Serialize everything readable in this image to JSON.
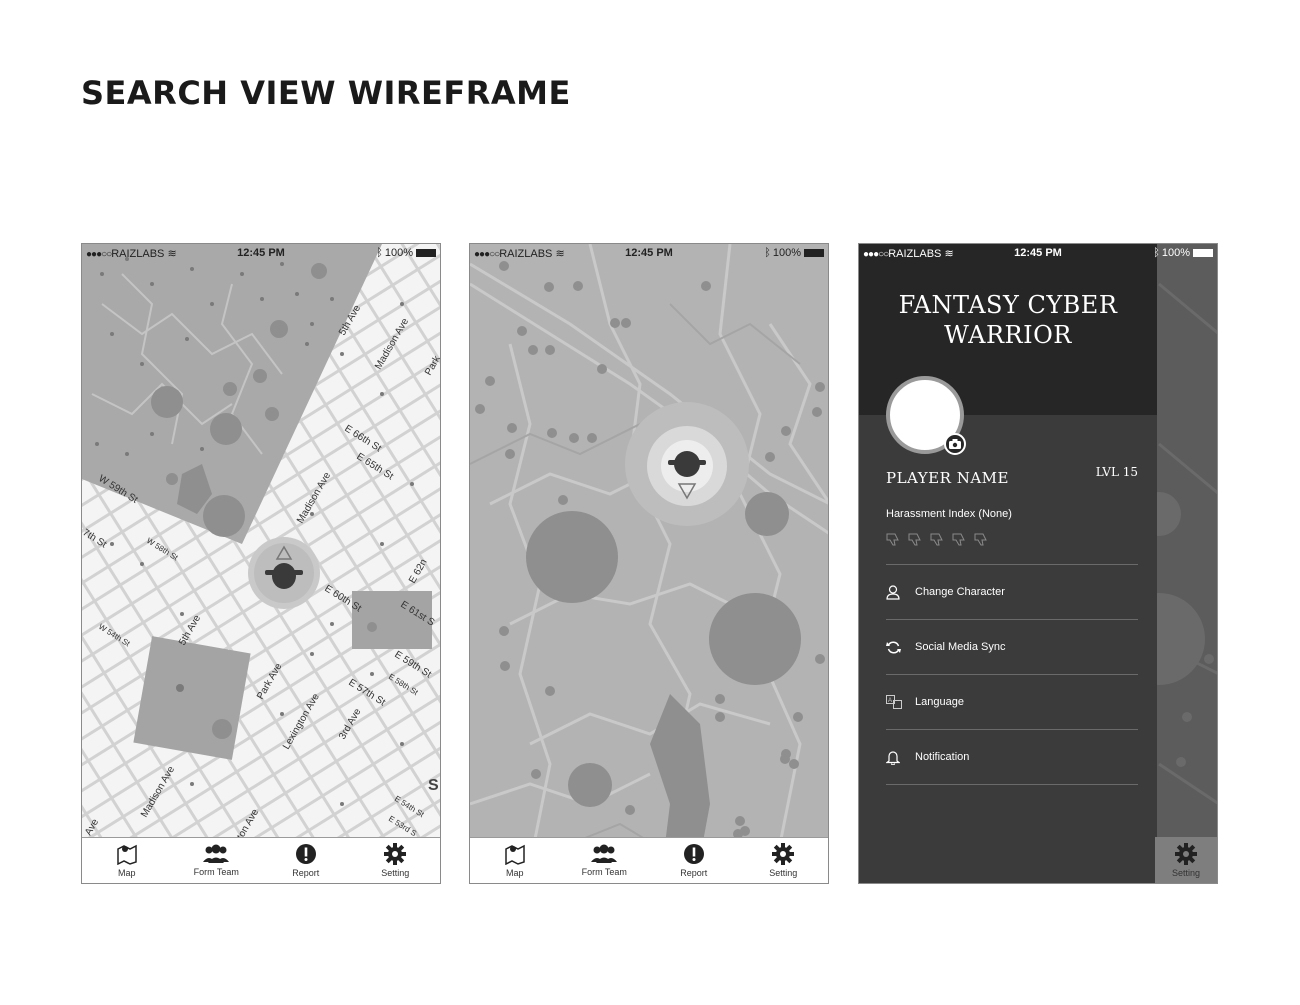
{
  "page": {
    "title": "SEARCH VIEW WIREFRAME"
  },
  "status_bar": {
    "carrier": "RAIZLABS",
    "time": "12:45 PM",
    "battery": "100%"
  },
  "tab_bar": {
    "items": [
      {
        "label": "Map",
        "icon": "map-pin-icon"
      },
      {
        "label": "Form Team",
        "icon": "team-icon"
      },
      {
        "label": "Report",
        "icon": "alert-icon"
      },
      {
        "label": "Setting",
        "icon": "gear-icon"
      }
    ]
  },
  "street_labels": {
    "fifth_ave_top": "5th Ave",
    "madison_ave_top": "Madison Ave",
    "park_ave_top": "Park",
    "e66": "E 66th St",
    "e65": "E 65th St",
    "madison_ave_mid": "Madison Ave",
    "w59": "W 59th St",
    "w58": "W 58th St",
    "seventh_ave": "7th St",
    "w54": "W 54th St",
    "fifth_ave_mid": "5th Ave",
    "park_ave_mid": "Park Ave",
    "e60": "E 60th St",
    "e62": "E 62n",
    "e61": "E 61st S",
    "e59": "E 59th St",
    "e58": "E 58th St",
    "e57": "E 57th St",
    "lexington": "Lexington Ave",
    "third_ave": "3rd Ave",
    "madison_ave_low": "Madison Ave",
    "ave_low": "Ave",
    "ton_ave": "ton Ave",
    "e54": "E 54th St",
    "e53": "E 53rd S",
    "s_letter": "S"
  },
  "menu": {
    "game_title_line1": "FANTASY CYBER",
    "game_title_line2": "WARRIOR",
    "player_name": "PLAYER NAME",
    "level": "LVL 15",
    "harassment_label": "Harassment Index (None)",
    "items": [
      {
        "label": "Change Character",
        "icon": "user-icon"
      },
      {
        "label": "Social Media Sync",
        "icon": "sync-icon"
      },
      {
        "label": "Language",
        "icon": "translate-icon"
      },
      {
        "label": "Notification",
        "icon": "bell-icon"
      }
    ],
    "visible_tab": {
      "label": "Setting",
      "icon": "gear-icon"
    }
  }
}
